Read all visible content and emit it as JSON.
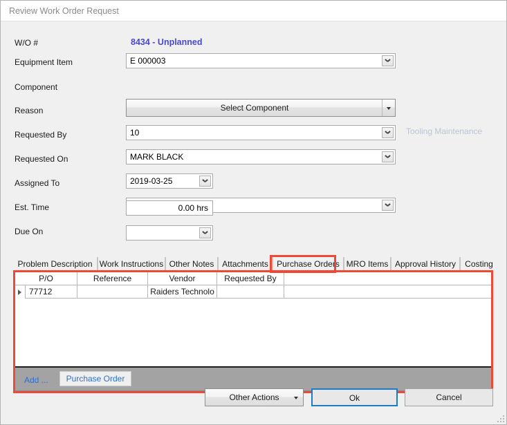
{
  "window": {
    "title": "Review Work Order Request"
  },
  "form": {
    "wo_number": {
      "label": "W/O #",
      "value": "8434 - Unplanned",
      "color": "#4a4ac4"
    },
    "equipment_item": {
      "label": "Equipment Item",
      "value": "E 000003"
    },
    "component": {
      "label": "Component",
      "button_label": "Select Component"
    },
    "reason": {
      "label": "Reason",
      "value": "10",
      "side_note": "Tooling Maintenance"
    },
    "requested_by": {
      "label": "Requested By",
      "value": "MARK BLACK"
    },
    "requested_on": {
      "label": "Requested On",
      "value": "2019-03-25"
    },
    "assigned_to": {
      "label": "Assigned To",
      "value": ""
    },
    "est_time": {
      "label": "Est. Time",
      "value": "0.00 hrs"
    },
    "due_on": {
      "label": "Due On",
      "value": ""
    }
  },
  "tabs": [
    {
      "label": "Problem Description",
      "selected": false
    },
    {
      "label": "Work Instructions",
      "selected": false
    },
    {
      "label": "Other Notes",
      "selected": false
    },
    {
      "label": "Attachments",
      "selected": false
    },
    {
      "label": "Purchase Orders",
      "selected": true
    },
    {
      "label": "MRO Items",
      "selected": false
    },
    {
      "label": "Approval History",
      "selected": false
    },
    {
      "label": "Costing",
      "selected": false
    }
  ],
  "grid": {
    "columns": [
      "P/O",
      "Reference",
      "Vendor",
      "Requested By"
    ],
    "rows": [
      {
        "selected": true,
        "po": "77712",
        "reference": "",
        "vendor": "Raiders Technolo",
        "requested_by": ""
      }
    ]
  },
  "grid_footer": {
    "add_label": "Add ...",
    "purchase_order_label": "Purchase Order"
  },
  "footer_buttons": {
    "other_actions": "Other Actions",
    "ok": "Ok",
    "cancel": "Cancel"
  },
  "annotations": {
    "accent_color": "#ee4836",
    "tab_highlight": "Purchase Orders",
    "panel_highlight": "Purchase Orders grid panel"
  }
}
